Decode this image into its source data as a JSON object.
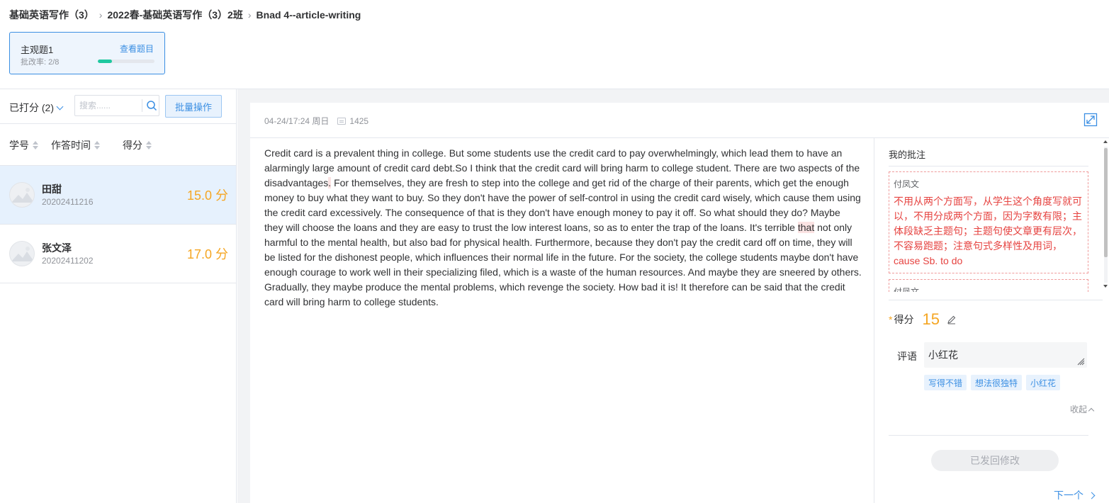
{
  "breadcrumb": {
    "items": [
      "基础英语写作（3）",
      "2022春-基础英语写作（3）2班",
      "Bnad 4--article-writing"
    ]
  },
  "question_card": {
    "title": "主观题1",
    "rate_label": "批改率: 2/8",
    "view_link": "查看题目",
    "progress_fraction": 0.25
  },
  "sidebar": {
    "filter_label": "已打分 (2)",
    "search_placeholder": "搜索......",
    "batch_button": "批量操作",
    "columns": [
      "学号",
      "作答时间",
      "得分"
    ],
    "students": [
      {
        "name": "田甜",
        "id": "20202411216",
        "score": "15.0 分",
        "active": true
      },
      {
        "name": "张文泽",
        "id": "20202411202",
        "score": "17.0 分",
        "active": false
      }
    ]
  },
  "submission": {
    "timestamp": "04-24/17:24 周日",
    "word_count": "1425",
    "essay": {
      "part1": "Credit card is a prevalent thing in college. But some students use the credit card to pay overwhelmingly, which lead them to have an alarmingly large amount of credit card debt.So I think that the credit card will bring harm to college student. There are two aspects of the disadvantages",
      "hl1": ".",
      "part2": " For themselves, they are fresh to step into the college and get rid of the charge of their parents, which get the enough money to buy what they want to buy. So they don't have the power of self-control in using the credit card wisely, which cause them using the credit card excessively. The consequence of that is they don't have enough money to pay it off. So what should they do? Maybe they will choose the loans and they are easy to trust the low interest loans, so as to enter the trap of the loans. It's terrible ",
      "hl2": "that",
      "part3": " not only harmful to the mental health, but also bad for physical health. Furthermore, because they don't pay the credit card off on time, they will be listed for the dishonest people, which influences their normal life in the future. For the society, the college students maybe don't have enough courage to work well in their specializing filed, which is a waste of the human resources. And maybe they are sneered by others. Gradually, they maybe produce the mental problems, which revenge the society. How bad it is! It therefore can be said that the credit card will bring harm to college students."
    }
  },
  "grading": {
    "annotations_title": "我的批注",
    "annotations": [
      {
        "author": "付凤文",
        "text": "不用从两个方面写，从学生这个角度写就可以，不用分成两个方面，因为字数有限；主体段缺乏主题句；主题句使文章更有层次，不容易跑题；注意句式多样性及用词，cause Sb. to do"
      },
      {
        "author": "付凤文",
        "text": ""
      }
    ],
    "score_star": "*",
    "score_label": "得分",
    "score_value": "15",
    "comment_label": "评语",
    "comment_value": "小红花",
    "tags": [
      "写得不错",
      "想法很独特",
      "小红花"
    ],
    "collapse_label": "收起",
    "returned_button": "已发回修改",
    "next_label": "下一个"
  },
  "colors": {
    "accent": "#3b8fe3",
    "score": "#f5a623",
    "annotation": "#e64340",
    "progress": "#1fc8a0"
  }
}
